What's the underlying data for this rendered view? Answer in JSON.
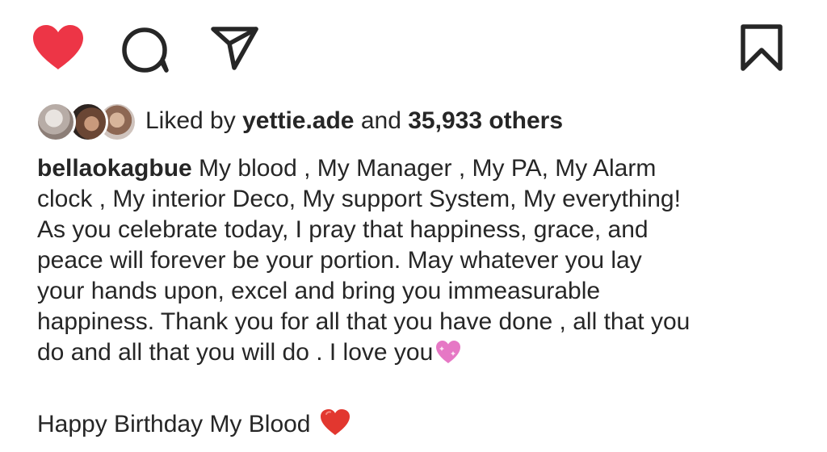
{
  "actions": {
    "like_color": "#ed3546",
    "icons": [
      "heart-icon",
      "comment-icon",
      "share-icon",
      "bookmark-icon"
    ]
  },
  "likes": {
    "prefix": "Liked by",
    "user": "yettie.ade",
    "connector": "and",
    "count_text": "35,933 others"
  },
  "caption": {
    "username": "bellaokagbue",
    "line1": " My blood , My Manager , My PA, My Alarm",
    "line2": "clock , My interior Deco, My support System, My everything!",
    "line3": "As you celebrate today,  I pray that happiness, grace, and",
    "line4": "peace will forever be your portion. May whatever you lay",
    "line5": "your hands upon, excel and bring you immeasurable",
    "line6": "happiness. Thank you for all that you have done , all that you",
    "line7": "do and all that you will do . I love you",
    "line7_emoji": "sparkling-heart-icon",
    "birthday": "Happy Birthday My Blood ",
    "birthday_emoji": "red-heart-icon"
  }
}
